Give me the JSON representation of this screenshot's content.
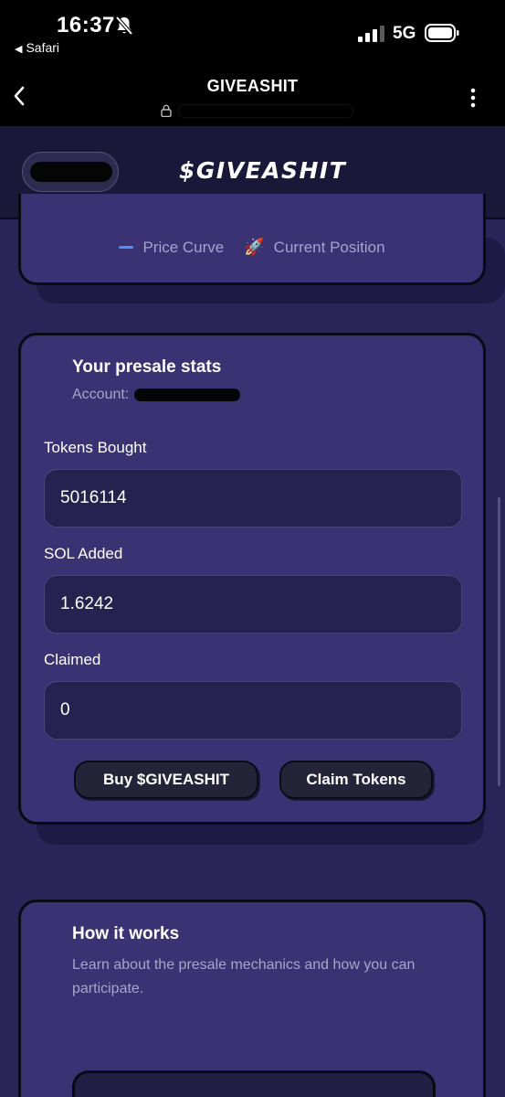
{
  "status_bar": {
    "time": "16:37",
    "back_app": "Safari",
    "network": "5G"
  },
  "browser": {
    "title": "GIVEASHIT"
  },
  "site": {
    "logo": "$GIVEASHIT"
  },
  "chart_legend": {
    "items": [
      {
        "label": "Price Curve",
        "icon": "line-icon",
        "color": "#4f8ff7"
      },
      {
        "label": "Current Position",
        "icon": "rocket-icon"
      }
    ]
  },
  "stats": {
    "title": "Your presale stats",
    "account_label": "Account:",
    "fields": [
      {
        "label": "Tokens Bought",
        "value": "5016114"
      },
      {
        "label": "SOL Added",
        "value": "1.6242"
      },
      {
        "label": "Claimed",
        "value": "0"
      }
    ],
    "buttons": {
      "buy": "Buy $GIVEASHIT",
      "claim": "Claim Tokens"
    }
  },
  "how_it_works": {
    "title": "How it works",
    "description": "Learn about the presale mechanics and how you can participate."
  },
  "colors": {
    "page_bg": "#2a2458",
    "card_bg": "#3a3273",
    "header_bg": "#1a1838",
    "field_bg": "#26224f",
    "accent_line": "#4f8ff7"
  }
}
